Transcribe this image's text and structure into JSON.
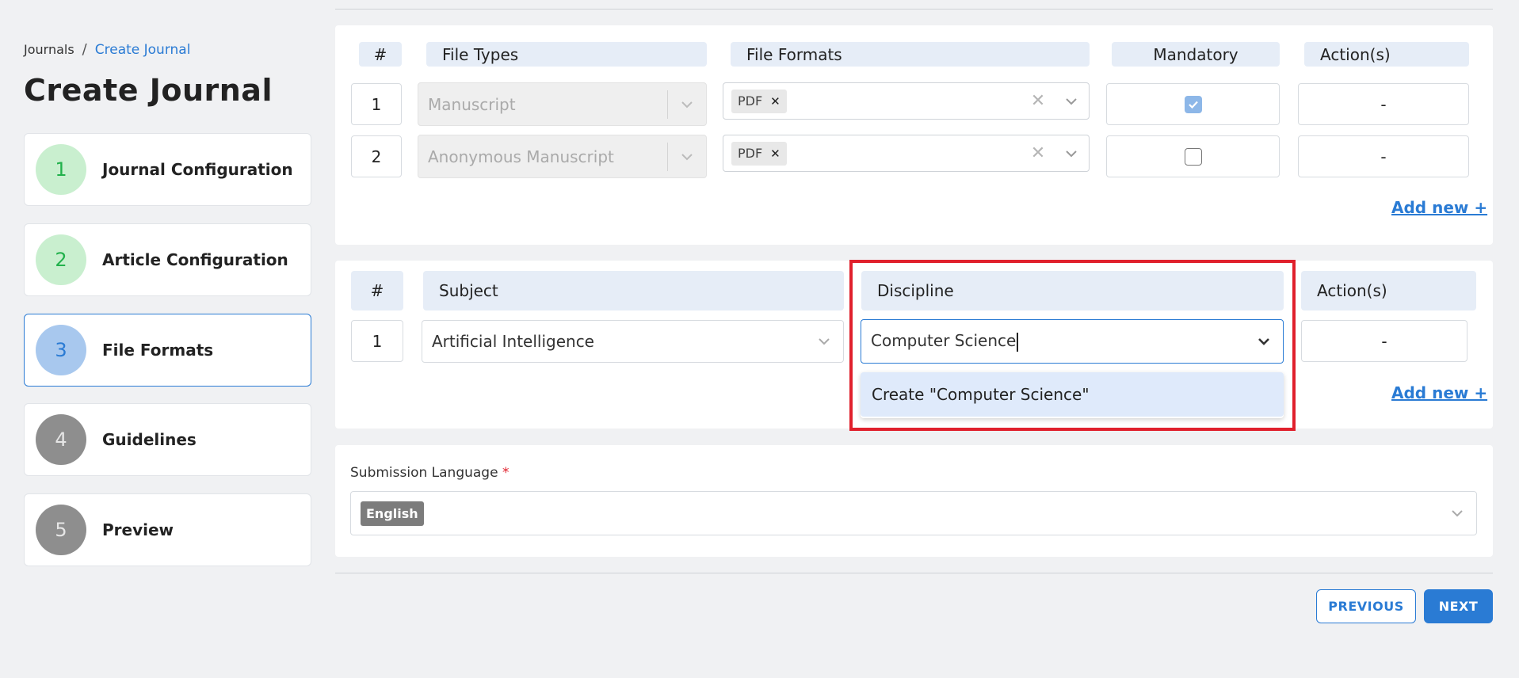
{
  "breadcrumb": {
    "root": "Journals",
    "separator": "/",
    "current": "Create Journal"
  },
  "page_title": "Create Journal",
  "steps": [
    {
      "number": "1",
      "label": "Journal Configuration",
      "state": "completed"
    },
    {
      "number": "2",
      "label": "Article Configuration",
      "state": "completed"
    },
    {
      "number": "3",
      "label": "File Formats",
      "state": "current"
    },
    {
      "number": "4",
      "label": "Guidelines",
      "state": "pending"
    },
    {
      "number": "5",
      "label": "Preview",
      "state": "pending"
    }
  ],
  "file_table": {
    "headers": {
      "num": "#",
      "file_types": "File Types",
      "file_formats": "File Formats",
      "mandatory": "Mandatory",
      "actions": "Action(s)"
    },
    "rows": [
      {
        "num": "1",
        "file_type": "Manuscript",
        "format_chip": "PDF",
        "mandatory": true,
        "action": "-"
      },
      {
        "num": "2",
        "file_type": "Anonymous Manuscript",
        "format_chip": "PDF",
        "mandatory": false,
        "action": "-"
      }
    ],
    "add_new": "Add new +"
  },
  "subject_table": {
    "headers": {
      "num": "#",
      "subject": "Subject",
      "discipline": "Discipline",
      "actions": "Action(s)"
    },
    "rows": [
      {
        "num": "1",
        "subject": "Artificial Intelligence",
        "discipline_input": "Computer Science",
        "action": "-"
      }
    ],
    "dropdown_option": "Create \"Computer Science\"",
    "add_new": "Add new +"
  },
  "submission_language": {
    "label": "Submission Language",
    "required_marker": "*",
    "selected": "English"
  },
  "buttons": {
    "previous": "PREVIOUS",
    "next": "NEXT"
  },
  "colors": {
    "accent": "#2a7bd4",
    "highlight": "#e0202c",
    "done": "#22b14c"
  }
}
